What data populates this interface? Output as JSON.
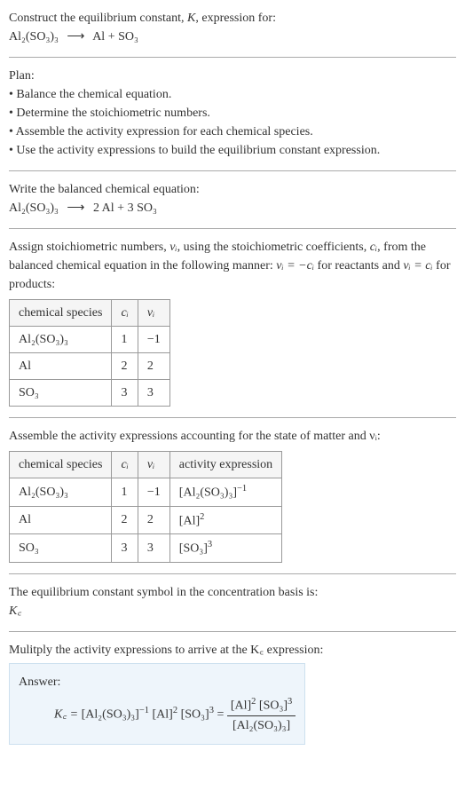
{
  "intro": {
    "line1": "Construct the equilibrium constant, ",
    "Ksym": "K",
    "line2": ", expression for:",
    "eq_left": "Al₂(SO₃)₃",
    "arrow": "⟶",
    "eq_right": "Al + SO₃"
  },
  "plan": {
    "title": "Plan:",
    "items": [
      "Balance the chemical equation.",
      "Determine the stoichiometric numbers.",
      "Assemble the activity expression for each chemical species.",
      "Use the activity expressions to build the equilibrium constant expression."
    ]
  },
  "balanced": {
    "title": "Write the balanced chemical equation:",
    "left": "Al₂(SO₃)₃",
    "arrow": "⟶",
    "right": "2 Al + 3 SO₃"
  },
  "assign": {
    "text_pre": "Assign stoichiometric numbers, ",
    "nu": "νᵢ",
    "text_mid1": ", using the stoichiometric coefficients, ",
    "ci": "cᵢ",
    "text_mid2": ", from the balanced chemical equation in the following manner: ",
    "eq1": "νᵢ = −cᵢ",
    "text_mid3": " for reactants and ",
    "eq2": "νᵢ = cᵢ",
    "text_end": " for products:"
  },
  "table1": {
    "headers": [
      "chemical species",
      "cᵢ",
      "νᵢ"
    ],
    "rows": [
      [
        "Al₂(SO₃)₃",
        "1",
        "−1"
      ],
      [
        "Al",
        "2",
        "2"
      ],
      [
        "SO₃",
        "3",
        "3"
      ]
    ]
  },
  "assemble": {
    "text": "Assemble the activity expressions accounting for the state of matter and νᵢ:"
  },
  "table2": {
    "headers": [
      "chemical species",
      "cᵢ",
      "νᵢ",
      "activity expression"
    ],
    "rows": [
      {
        "sp": "Al₂(SO₃)₃",
        "c": "1",
        "nu": "−1",
        "act_base": "[Al₂(SO₃)₃]",
        "act_exp": "−1"
      },
      {
        "sp": "Al",
        "c": "2",
        "nu": "2",
        "act_base": "[Al]",
        "act_exp": "2"
      },
      {
        "sp": "SO₃",
        "c": "3",
        "nu": "3",
        "act_base": "[SO₃]",
        "act_exp": "3"
      }
    ]
  },
  "basis": {
    "line": "The equilibrium constant symbol in the concentration basis is:",
    "sym": "K꜀"
  },
  "multiply": {
    "line": "Mulitply the activity expressions to arrive at the K꜀ expression:"
  },
  "answer": {
    "label": "Answer:",
    "lhs": "K꜀ = ",
    "term1_base": "[Al₂(SO₃)₃]",
    "term1_exp": "−1",
    "term2_base": "[Al]",
    "term2_exp": "2",
    "term3_base": "[SO₃]",
    "term3_exp": "3",
    "eq": " = ",
    "num1_base": "[Al]",
    "num1_exp": "2",
    "num2_base": "[SO₃]",
    "num2_exp": "3",
    "den": "[Al₂(SO₃)₃]"
  },
  "chart_data": {
    "type": "table",
    "tables": [
      {
        "title": "Stoichiometric numbers",
        "columns": [
          "chemical species",
          "c_i",
          "nu_i"
        ],
        "rows": [
          [
            "Al2(SO3)3",
            1,
            -1
          ],
          [
            "Al",
            2,
            2
          ],
          [
            "SO3",
            3,
            3
          ]
        ]
      },
      {
        "title": "Activity expressions",
        "columns": [
          "chemical species",
          "c_i",
          "nu_i",
          "activity expression"
        ],
        "rows": [
          [
            "Al2(SO3)3",
            1,
            -1,
            "[Al2(SO3)3]^(-1)"
          ],
          [
            "Al",
            2,
            2,
            "[Al]^2"
          ],
          [
            "SO3",
            3,
            3,
            "[SO3]^3"
          ]
        ]
      }
    ],
    "result": "K_c = [Al]^2 [SO3]^3 / [Al2(SO3)3]"
  }
}
